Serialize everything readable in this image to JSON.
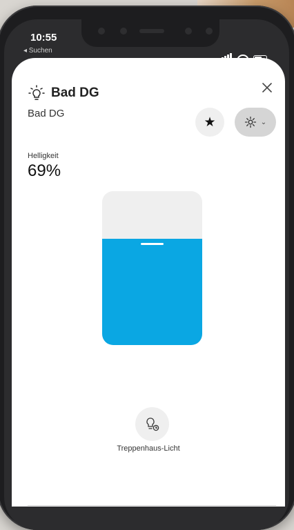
{
  "status_bar": {
    "time": "10:55",
    "back_label": "◂ Suchen"
  },
  "device": {
    "title": "Bad DG",
    "room": "Bad DG"
  },
  "brightness": {
    "label": "Helligkeit",
    "value_text": "69%",
    "level": 0.69
  },
  "actions": {
    "favorite_icon": "★",
    "settings_chevron": "⌄"
  },
  "staircase": {
    "label": "Treppenhaus-Licht"
  },
  "colors": {
    "accent": "#0aa7e3",
    "sheet": "#ffffff",
    "slider_track": "#efefef"
  },
  "icons": [
    "light-bulb-icon",
    "close-icon",
    "star-icon",
    "gear-icon",
    "chevron-down-icon",
    "bulb-timer-icon"
  ]
}
